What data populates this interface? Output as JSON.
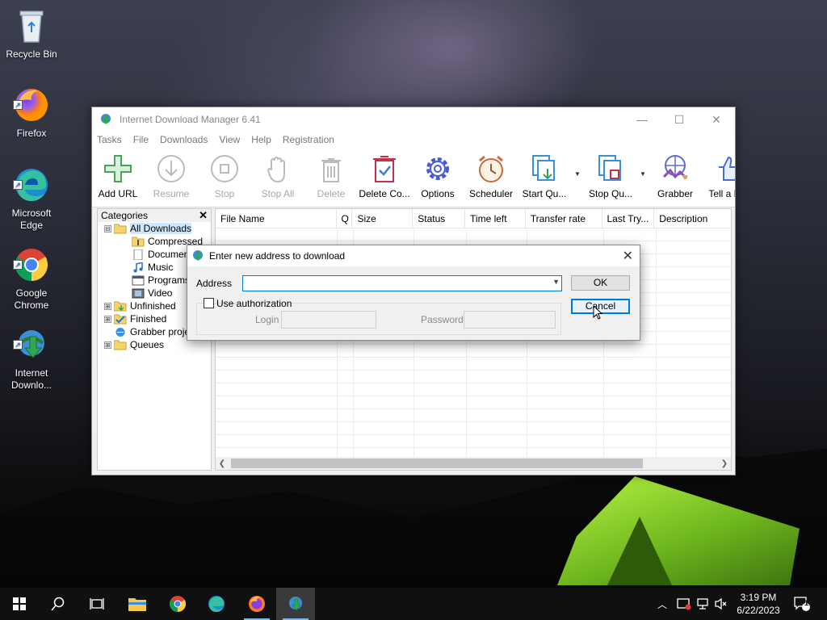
{
  "desktop": {
    "icons": [
      {
        "label": "Recycle Bin"
      },
      {
        "label": "Firefox"
      },
      {
        "label": "Microsoft Edge"
      },
      {
        "label": "Google Chrome"
      },
      {
        "label": "Internet Downlo..."
      }
    ]
  },
  "idm": {
    "title": "Internet Download Manager 6.41",
    "menu": [
      "Tasks",
      "File",
      "Downloads",
      "View",
      "Help",
      "Registration"
    ],
    "toolbar": [
      {
        "label": "Add URL",
        "icon": "plus-icon",
        "enabled": true
      },
      {
        "label": "Resume",
        "icon": "resume-icon",
        "enabled": false
      },
      {
        "label": "Stop",
        "icon": "stop-icon",
        "enabled": false
      },
      {
        "label": "Stop All",
        "icon": "hand-icon",
        "enabled": false
      },
      {
        "label": "Delete",
        "icon": "trash-icon",
        "enabled": false
      },
      {
        "label": "Delete Co...",
        "icon": "delete-completed-icon",
        "enabled": true
      },
      {
        "label": "Options",
        "icon": "gear-icon",
        "enabled": true
      },
      {
        "label": "Scheduler",
        "icon": "alarm-clock-icon",
        "enabled": true
      },
      {
        "label": "Start Qu...",
        "icon": "start-queue-icon",
        "enabled": true
      },
      {
        "label": "Stop Qu...",
        "icon": "stop-queue-icon",
        "enabled": true
      },
      {
        "label": "Grabber",
        "icon": "grabber-icon",
        "enabled": true
      },
      {
        "label": "Tell a Fri",
        "icon": "thumbs-up-icon",
        "enabled": true
      }
    ],
    "categories": {
      "header": "Categories",
      "items": [
        {
          "label": "All Downloads",
          "level": 0,
          "expander": "⊟",
          "selected": true
        },
        {
          "label": "Compressed",
          "level": 1
        },
        {
          "label": "Documents",
          "level": 1
        },
        {
          "label": "Music",
          "level": 1
        },
        {
          "label": "Programs",
          "level": 1
        },
        {
          "label": "Video",
          "level": 1
        },
        {
          "label": "Unfinished",
          "level": 0,
          "expander": "⊞"
        },
        {
          "label": "Finished",
          "level": 0,
          "expander": "⊞"
        },
        {
          "label": "Grabber projects",
          "level": 0,
          "expander": ""
        },
        {
          "label": "Queues",
          "level": 0,
          "expander": "⊞"
        }
      ]
    },
    "columns": [
      "File Name",
      "Q",
      "Size",
      "Status",
      "Time left",
      "Transfer rate",
      "Last Try...",
      "Description"
    ]
  },
  "dialog": {
    "title": "Enter new address to download",
    "address_label": "Address",
    "address_value": "",
    "ok_label": "OK",
    "cancel_label": "Cancel",
    "use_auth_label": "Use authorization",
    "login_label": "Login",
    "password_label": "Password"
  },
  "taskbar": {
    "time": "3:19 PM",
    "date": "6/22/2023",
    "notification_count": "1"
  },
  "colors": {
    "accent": "#0078d7",
    "selection": "#cce8ff"
  }
}
